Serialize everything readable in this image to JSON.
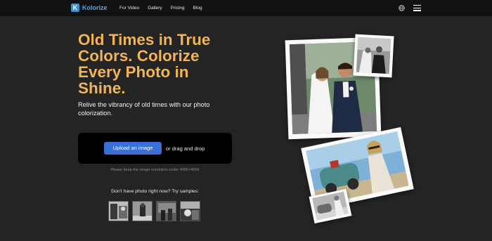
{
  "nav": {
    "brand_letter": "K",
    "brand_name": "Kolorize",
    "links": [
      "For Video",
      "Gallery",
      "Pricing",
      "Blog"
    ],
    "globe_icon": "globe-icon",
    "menu_icon": "hamburger-menu-icon"
  },
  "hero": {
    "headline": "Old Times in True Colors. Colorize Every Photo in Shine.",
    "subtext": "Relive the vibrancy of old times with our photo colorization."
  },
  "upload": {
    "button_label": "Upload an image",
    "drag_text": "or drag and drop",
    "hint": "Please keep the image resolution under 4096×4096"
  },
  "samples": {
    "title": "Don't have photo right now? Try samples:",
    "count": 4
  },
  "colors": {
    "accent": "#f0b45a",
    "button": "#3b6fd8",
    "background": "#242424",
    "nav": "#111111"
  }
}
